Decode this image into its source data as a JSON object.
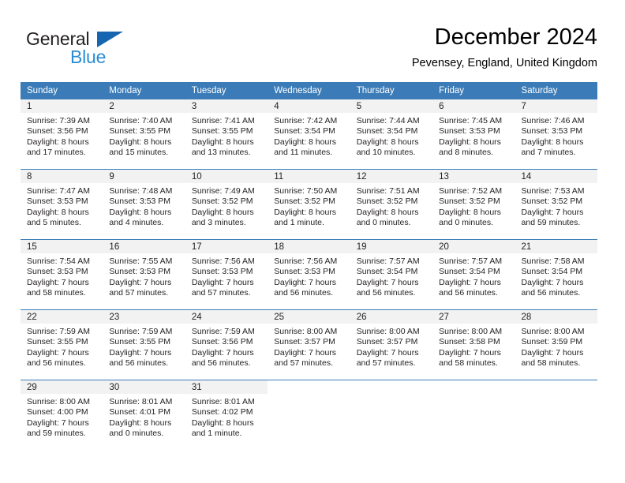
{
  "brand": {
    "name_part1": "General",
    "name_part2": "Blue"
  },
  "header": {
    "title": "December 2024",
    "subtitle": "Pevensey, England, United Kingdom"
  },
  "colors": {
    "header_blue": "#3b7cb8",
    "logo_blue": "#2b8bd4",
    "logo_triangle": "#1565b0",
    "daynum_band": "#f2f2f2",
    "text": "#231f20"
  },
  "weekdays": [
    "Sunday",
    "Monday",
    "Tuesday",
    "Wednesday",
    "Thursday",
    "Friday",
    "Saturday"
  ],
  "weeks": [
    [
      {
        "day": "1",
        "sunrise": "Sunrise: 7:39 AM",
        "sunset": "Sunset: 3:56 PM",
        "daylight": "Daylight: 8 hours and 17 minutes."
      },
      {
        "day": "2",
        "sunrise": "Sunrise: 7:40 AM",
        "sunset": "Sunset: 3:55 PM",
        "daylight": "Daylight: 8 hours and 15 minutes."
      },
      {
        "day": "3",
        "sunrise": "Sunrise: 7:41 AM",
        "sunset": "Sunset: 3:55 PM",
        "daylight": "Daylight: 8 hours and 13 minutes."
      },
      {
        "day": "4",
        "sunrise": "Sunrise: 7:42 AM",
        "sunset": "Sunset: 3:54 PM",
        "daylight": "Daylight: 8 hours and 11 minutes."
      },
      {
        "day": "5",
        "sunrise": "Sunrise: 7:44 AM",
        "sunset": "Sunset: 3:54 PM",
        "daylight": "Daylight: 8 hours and 10 minutes."
      },
      {
        "day": "6",
        "sunrise": "Sunrise: 7:45 AM",
        "sunset": "Sunset: 3:53 PM",
        "daylight": "Daylight: 8 hours and 8 minutes."
      },
      {
        "day": "7",
        "sunrise": "Sunrise: 7:46 AM",
        "sunset": "Sunset: 3:53 PM",
        "daylight": "Daylight: 8 hours and 7 minutes."
      }
    ],
    [
      {
        "day": "8",
        "sunrise": "Sunrise: 7:47 AM",
        "sunset": "Sunset: 3:53 PM",
        "daylight": "Daylight: 8 hours and 5 minutes."
      },
      {
        "day": "9",
        "sunrise": "Sunrise: 7:48 AM",
        "sunset": "Sunset: 3:53 PM",
        "daylight": "Daylight: 8 hours and 4 minutes."
      },
      {
        "day": "10",
        "sunrise": "Sunrise: 7:49 AM",
        "sunset": "Sunset: 3:52 PM",
        "daylight": "Daylight: 8 hours and 3 minutes."
      },
      {
        "day": "11",
        "sunrise": "Sunrise: 7:50 AM",
        "sunset": "Sunset: 3:52 PM",
        "daylight": "Daylight: 8 hours and 1 minute."
      },
      {
        "day": "12",
        "sunrise": "Sunrise: 7:51 AM",
        "sunset": "Sunset: 3:52 PM",
        "daylight": "Daylight: 8 hours and 0 minutes."
      },
      {
        "day": "13",
        "sunrise": "Sunrise: 7:52 AM",
        "sunset": "Sunset: 3:52 PM",
        "daylight": "Daylight: 8 hours and 0 minutes."
      },
      {
        "day": "14",
        "sunrise": "Sunrise: 7:53 AM",
        "sunset": "Sunset: 3:52 PM",
        "daylight": "Daylight: 7 hours and 59 minutes."
      }
    ],
    [
      {
        "day": "15",
        "sunrise": "Sunrise: 7:54 AM",
        "sunset": "Sunset: 3:53 PM",
        "daylight": "Daylight: 7 hours and 58 minutes."
      },
      {
        "day": "16",
        "sunrise": "Sunrise: 7:55 AM",
        "sunset": "Sunset: 3:53 PM",
        "daylight": "Daylight: 7 hours and 57 minutes."
      },
      {
        "day": "17",
        "sunrise": "Sunrise: 7:56 AM",
        "sunset": "Sunset: 3:53 PM",
        "daylight": "Daylight: 7 hours and 57 minutes."
      },
      {
        "day": "18",
        "sunrise": "Sunrise: 7:56 AM",
        "sunset": "Sunset: 3:53 PM",
        "daylight": "Daylight: 7 hours and 56 minutes."
      },
      {
        "day": "19",
        "sunrise": "Sunrise: 7:57 AM",
        "sunset": "Sunset: 3:54 PM",
        "daylight": "Daylight: 7 hours and 56 minutes."
      },
      {
        "day": "20",
        "sunrise": "Sunrise: 7:57 AM",
        "sunset": "Sunset: 3:54 PM",
        "daylight": "Daylight: 7 hours and 56 minutes."
      },
      {
        "day": "21",
        "sunrise": "Sunrise: 7:58 AM",
        "sunset": "Sunset: 3:54 PM",
        "daylight": "Daylight: 7 hours and 56 minutes."
      }
    ],
    [
      {
        "day": "22",
        "sunrise": "Sunrise: 7:59 AM",
        "sunset": "Sunset: 3:55 PM",
        "daylight": "Daylight: 7 hours and 56 minutes."
      },
      {
        "day": "23",
        "sunrise": "Sunrise: 7:59 AM",
        "sunset": "Sunset: 3:55 PM",
        "daylight": "Daylight: 7 hours and 56 minutes."
      },
      {
        "day": "24",
        "sunrise": "Sunrise: 7:59 AM",
        "sunset": "Sunset: 3:56 PM",
        "daylight": "Daylight: 7 hours and 56 minutes."
      },
      {
        "day": "25",
        "sunrise": "Sunrise: 8:00 AM",
        "sunset": "Sunset: 3:57 PM",
        "daylight": "Daylight: 7 hours and 57 minutes."
      },
      {
        "day": "26",
        "sunrise": "Sunrise: 8:00 AM",
        "sunset": "Sunset: 3:57 PM",
        "daylight": "Daylight: 7 hours and 57 minutes."
      },
      {
        "day": "27",
        "sunrise": "Sunrise: 8:00 AM",
        "sunset": "Sunset: 3:58 PM",
        "daylight": "Daylight: 7 hours and 58 minutes."
      },
      {
        "day": "28",
        "sunrise": "Sunrise: 8:00 AM",
        "sunset": "Sunset: 3:59 PM",
        "daylight": "Daylight: 7 hours and 58 minutes."
      }
    ],
    [
      {
        "day": "29",
        "sunrise": "Sunrise: 8:00 AM",
        "sunset": "Sunset: 4:00 PM",
        "daylight": "Daylight: 7 hours and 59 minutes."
      },
      {
        "day": "30",
        "sunrise": "Sunrise: 8:01 AM",
        "sunset": "Sunset: 4:01 PM",
        "daylight": "Daylight: 8 hours and 0 minutes."
      },
      {
        "day": "31",
        "sunrise": "Sunrise: 8:01 AM",
        "sunset": "Sunset: 4:02 PM",
        "daylight": "Daylight: 8 hours and 1 minute."
      },
      {
        "day": "",
        "sunrise": "",
        "sunset": "",
        "daylight": ""
      },
      {
        "day": "",
        "sunrise": "",
        "sunset": "",
        "daylight": ""
      },
      {
        "day": "",
        "sunrise": "",
        "sunset": "",
        "daylight": ""
      },
      {
        "day": "",
        "sunrise": "",
        "sunset": "",
        "daylight": ""
      }
    ]
  ]
}
